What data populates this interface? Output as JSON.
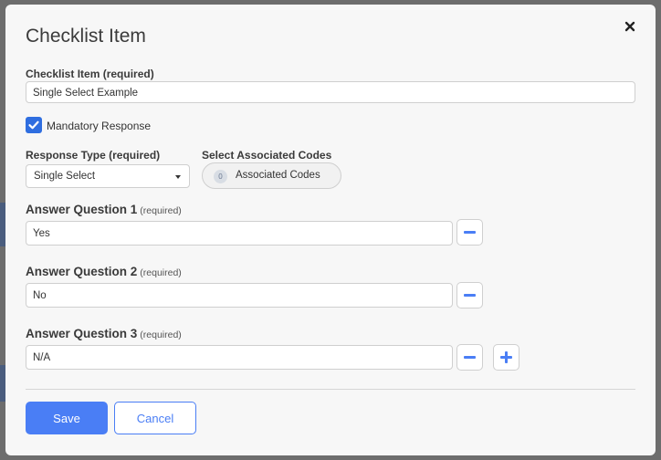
{
  "dialog": {
    "title": "Checklist Item"
  },
  "checklist_item": {
    "label": "Checklist Item (required)",
    "value": "Single Select Example"
  },
  "mandatory": {
    "label": "Mandatory Response",
    "checked": true
  },
  "response_type": {
    "label": "Response Type (required)",
    "selected": "Single Select"
  },
  "associated_codes": {
    "label": "Select Associated Codes",
    "count": "0",
    "button_label": "Associated Codes"
  },
  "answers": [
    {
      "label": "Answer Question 1",
      "required": "(required)",
      "value": "Yes"
    },
    {
      "label": "Answer Question 2",
      "required": "(required)",
      "value": "No"
    },
    {
      "label": "Answer Question 3",
      "required": "(required)",
      "value": "N/A"
    }
  ],
  "footer": {
    "save_label": "Save",
    "cancel_label": "Cancel"
  },
  "colors": {
    "accent": "#4a7ef5",
    "checkbox": "#2f6ee0"
  },
  "icons": {
    "close": "close-icon",
    "remove": "minus-icon",
    "add": "plus-icon",
    "check": "check-icon",
    "caret": "caret-down-icon"
  }
}
